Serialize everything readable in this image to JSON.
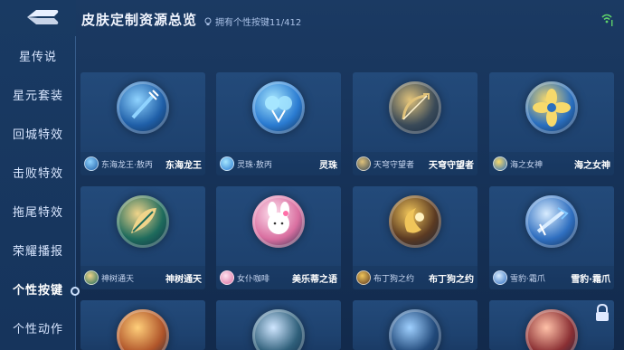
{
  "header": {
    "title": "皮肤定制资源总览",
    "subtitle": "拥有个性按键11/412"
  },
  "sidebar": {
    "items": [
      {
        "label": "星传说",
        "active": false
      },
      {
        "label": "星元套装",
        "active": false
      },
      {
        "label": "回城特效",
        "active": false
      },
      {
        "label": "击败特效",
        "active": false
      },
      {
        "label": "拖尾特效",
        "active": false
      },
      {
        "label": "荣耀播报",
        "active": false
      },
      {
        "label": "个性按键",
        "active": true
      },
      {
        "label": "个性动作",
        "active": false
      }
    ]
  },
  "cards": [
    {
      "hero": "东海龙王·敖丙",
      "skin": "东海龙王",
      "theme": "#1f5fa8",
      "accent": "#8fd3ff",
      "icon": "trident-icon"
    },
    {
      "hero": "灵珠·敖丙",
      "skin": "灵珠",
      "theme": "#2a7bd1",
      "accent": "#a6e6ff",
      "icon": "orb-icon"
    },
    {
      "hero": "天穹守望者",
      "skin": "天穹守望者",
      "theme": "#3a4a58",
      "accent": "#e0c27a",
      "icon": "bow-icon"
    },
    {
      "hero": "海之女神",
      "skin": "海之女神",
      "theme": "#2a6fbf",
      "accent": "#f7d96b",
      "icon": "flower-icon"
    },
    {
      "hero": "神树通天",
      "skin": "神树通天",
      "theme": "#1e6b5c",
      "accent": "#f0d48a",
      "icon": "leaf-icon"
    },
    {
      "hero": "女仆咖啡",
      "skin": "美乐蒂之语",
      "theme": "#d96fa0",
      "accent": "#ffe3f0",
      "icon": "melody-icon"
    },
    {
      "hero": "布丁狗之约",
      "skin": "布丁狗之约",
      "theme": "#5b3a22",
      "accent": "#f0c55a",
      "icon": "crescent-icon"
    },
    {
      "hero": "雪豹·霜爪",
      "skin": "雪豹·霜爪",
      "theme": "#2f6fc0",
      "accent": "#d8ecff",
      "icon": "claw-icon"
    }
  ]
}
